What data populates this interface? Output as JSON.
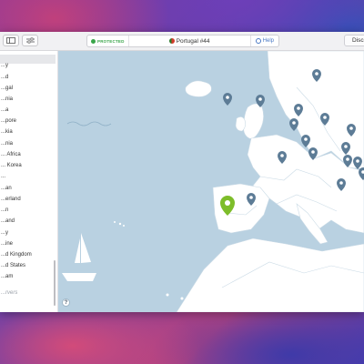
{
  "toolbar": {
    "status": "PROTECTED",
    "server": "Portugal #44",
    "help": "Help",
    "disconnect": "Disconnect",
    "sidebar_toggle_icon": "sidebar-icon",
    "settings_icon": "sliders-icon"
  },
  "sidebar": {
    "items": [
      {
        "label": "...y"
      },
      {
        "label": "...d"
      },
      {
        "label": "...gal"
      },
      {
        "label": "...nia"
      },
      {
        "label": "...a"
      },
      {
        "label": "...pore"
      },
      {
        "label": "...kia"
      },
      {
        "label": "...nia"
      },
      {
        "label": "... Africa"
      },
      {
        "label": "... Korea"
      },
      {
        "label": "..."
      },
      {
        "label": "...an"
      },
      {
        "label": "...erland"
      },
      {
        "label": "...n"
      },
      {
        "label": "...and"
      },
      {
        "label": "...y"
      },
      {
        "label": "...ine"
      },
      {
        "label": "...d Kingdom"
      },
      {
        "label": "...d States"
      },
      {
        "label": "...am"
      }
    ],
    "specialty_label": "...rvers"
  },
  "map": {
    "help_label": "?",
    "ocean_color": "#b9d1e1",
    "land_color": "#ffffff",
    "active_pin_color": "#7dbd2a",
    "pin_color": "#5d7c96"
  }
}
